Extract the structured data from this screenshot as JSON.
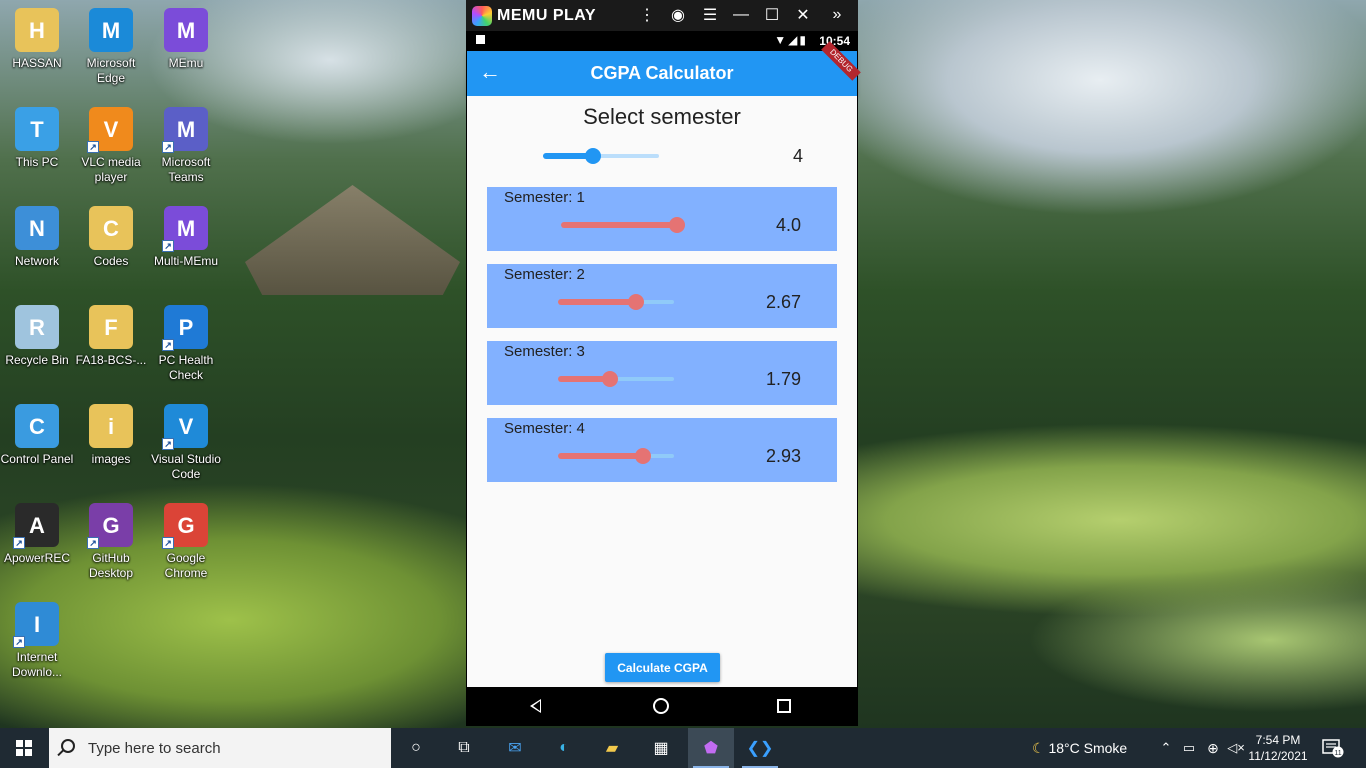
{
  "desktop": {
    "icons": [
      {
        "label": "HASSAN",
        "icon": "user-folder-icon",
        "color": "#e8c35a"
      },
      {
        "label": "Microsoft Edge",
        "icon": "edge-icon",
        "color": "#1b8ad8"
      },
      {
        "label": "MEmu",
        "icon": "memu-icon",
        "color": "#7b4cd9"
      },
      {
        "label": "This PC",
        "icon": "computer-icon",
        "color": "#3aa0e6"
      },
      {
        "label": "VLC media player",
        "icon": "vlc-icon",
        "color": "#f08a1c"
      },
      {
        "label": "Microsoft Teams",
        "icon": "teams-icon",
        "color": "#5b5fc7"
      },
      {
        "label": "Network",
        "icon": "network-icon",
        "color": "#3d8fd8"
      },
      {
        "label": "Codes",
        "icon": "folder-icon",
        "color": "#e8c35a"
      },
      {
        "label": "Multi-MEmu",
        "icon": "multi-memu-icon",
        "color": "#7b4cd9"
      },
      {
        "label": "Recycle Bin",
        "icon": "recycle-bin-icon",
        "color": "#9fc4de"
      },
      {
        "label": "FA18-BCS-...",
        "icon": "folder-icon",
        "color": "#e8c35a"
      },
      {
        "label": "PC Health Check",
        "icon": "health-check-icon",
        "color": "#1f7ad6"
      },
      {
        "label": "Control Panel",
        "icon": "control-panel-icon",
        "color": "#3a9be0"
      },
      {
        "label": "images",
        "icon": "folder-icon",
        "color": "#e8c35a"
      },
      {
        "label": "Visual Studio Code",
        "icon": "vscode-icon",
        "color": "#1f8ad8"
      },
      {
        "label": "ApowerREC",
        "icon": "apowerrec-icon",
        "color": "#2a2a2a"
      },
      {
        "label": "GitHub Desktop",
        "icon": "github-icon",
        "color": "#7a3ea8"
      },
      {
        "label": "Google Chrome",
        "icon": "chrome-icon",
        "color": "#db4437"
      },
      {
        "label": "Internet Downlo...",
        "icon": "idm-icon",
        "color": "#2f8bd6"
      }
    ]
  },
  "emulator": {
    "title": "MEMU PLAY",
    "controls": [
      "more-icon",
      "account-icon",
      "menu-icon",
      "minimize-icon",
      "maximize-icon",
      "close-icon",
      "expand-icon"
    ],
    "status_time": "10:54"
  },
  "app": {
    "title": "CGPA Calculator",
    "debug_banner": "DEBUG",
    "select_label": "Select semester",
    "semester_count": {
      "value": "4",
      "fraction": 0.43
    },
    "semesters": [
      {
        "label": "Semester: 1",
        "gpa": "4.0",
        "fraction": 1.0
      },
      {
        "label": "Semester: 2",
        "gpa": "2.67",
        "fraction": 0.67
      },
      {
        "label": "Semester: 3",
        "gpa": "1.79",
        "fraction": 0.45
      },
      {
        "label": "Semester: 4",
        "gpa": "2.93",
        "fraction": 0.73
      }
    ],
    "calculate_button": "Calculate CGPA"
  },
  "taskbar": {
    "search_placeholder": "Type here to search",
    "weather": "18°C  Smoke",
    "time": "7:54 PM",
    "date": "11/12/2021",
    "notifications": "11"
  },
  "colors": {
    "primary": "#2196f3",
    "card": "#82b1ff",
    "slider_active": "#e57373"
  }
}
